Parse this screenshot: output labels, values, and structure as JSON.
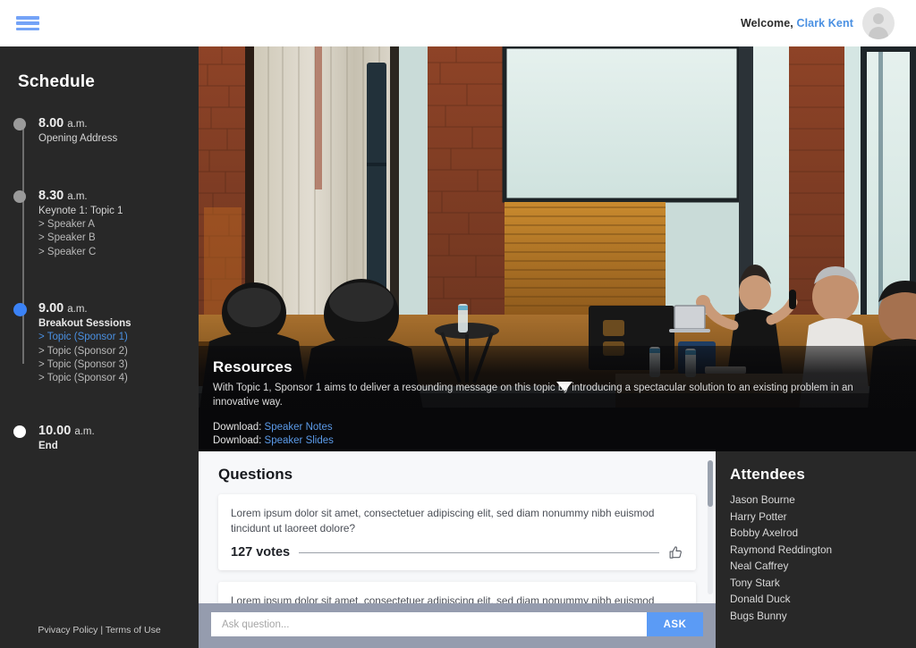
{
  "header": {
    "menu_icon": "hamburger-menu-icon",
    "welcome_prefix": "Welcome,",
    "user_name": "Clark Kent",
    "avatar_icon": "user-avatar-icon"
  },
  "sidebar": {
    "title": "Schedule",
    "timeline": [
      {
        "time": "8.00",
        "ampm": "a.m.",
        "title": "Opening Address",
        "state": "past",
        "items": []
      },
      {
        "time": "8.30",
        "ampm": "a.m.",
        "title": "Keynote 1: Topic 1",
        "state": "past",
        "items": [
          "> Speaker A",
          "> Speaker B",
          "> Speaker C"
        ]
      },
      {
        "time": "9.00",
        "ampm": "a.m.",
        "title": "Breakout Sessions",
        "state": "active",
        "items": [
          "> Topic (Sponsor 1)",
          "> Topic (Sponsor 2)",
          "> Topic (Sponsor 3)",
          "> Topic (Sponsor 4)"
        ]
      },
      {
        "time": "10.00",
        "ampm": "a.m.",
        "title": "End",
        "state": "end",
        "items": []
      }
    ],
    "footer": {
      "privacy": "Pvivacy Policy",
      "separator": "|",
      "terms": "Terms of Use",
      "full": "Pvivacy Policy | Terms of Use"
    }
  },
  "hero": {
    "scroll_cue_icon": "chevron-down-icon",
    "resources": {
      "title": "Resources",
      "description": "With Topic 1, Sponsor 1 aims to deliver a resounding message on this topic by introducing a spectacular solution to an existing problem in an innovative way.",
      "downloads": [
        {
          "label": "Download:",
          "link": "Speaker Notes"
        },
        {
          "label": "Download:",
          "link": "Speaker Slides"
        }
      ]
    }
  },
  "questions": {
    "title": "Questions",
    "items": [
      {
        "text": "Lorem ipsum dolor sit amet, consectetuer adipiscing elit, sed diam nonummy nibh euismod tincidunt ut laoreet dolore?",
        "votes": "127 votes",
        "vote_icon": "thumbs-up-icon"
      },
      {
        "text": "Lorem ipsum dolor sit amet, consectetuer adipiscing elit, sed diam nonummy nibh euismod tincidunt ut laoreet dolore?",
        "votes": "",
        "vote_icon": "thumbs-up-icon"
      }
    ],
    "ask": {
      "placeholder": "Ask question...",
      "value": "",
      "button_label": "ASK"
    }
  },
  "attendees": {
    "title": "Attendees",
    "names": [
      "Jason Bourne",
      "Harry Potter",
      "Bobby Axelrod",
      "Raymond Reddington",
      "Neal Caffrey",
      "Tony Stark",
      "Donald Duck",
      "Bugs Bunny"
    ]
  },
  "colors": {
    "accent_blue": "#4a90e2",
    "ask_button": "#5b9bf5",
    "dark_panel": "#282828",
    "band_gray": "#959cae",
    "questions_bg": "#f7f8fa",
    "active_dot": "#3b82f6"
  }
}
